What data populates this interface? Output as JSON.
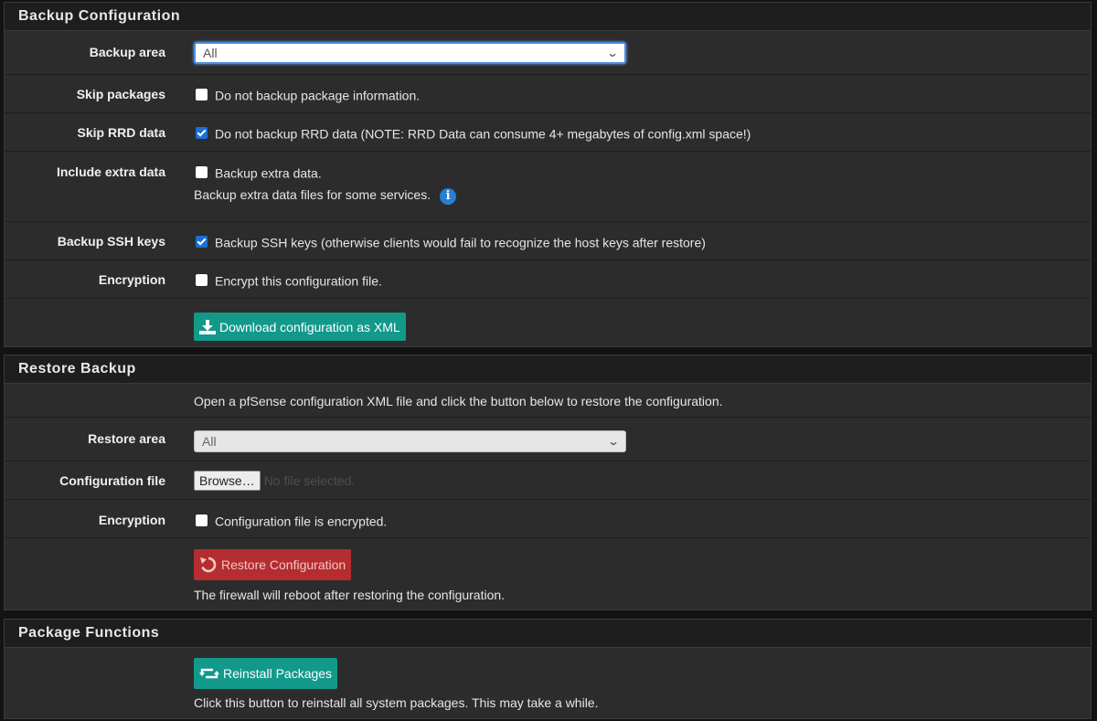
{
  "backup": {
    "title": "Backup Configuration",
    "area_label": "Backup area",
    "area_value": "All",
    "skip_packages_label": "Skip packages",
    "skip_packages_text": "Do not backup package information.",
    "skip_packages_checked": false,
    "skip_rrd_label": "Skip RRD data",
    "skip_rrd_text": "Do not backup RRD data (NOTE: RRD Data can consume 4+ megabytes of config.xml space!)",
    "skip_rrd_checked": true,
    "extra_label": "Include extra data",
    "extra_text": "Backup extra data.",
    "extra_help": "Backup extra data files for some services.",
    "extra_checked": false,
    "ssh_label": "Backup SSH keys",
    "ssh_text": "Backup SSH keys (otherwise clients would fail to recognize the host keys after restore)",
    "ssh_checked": true,
    "encryption_label": "Encryption",
    "encryption_text": "Encrypt this configuration file.",
    "encryption_checked": false,
    "download_button": "Download configuration as XML"
  },
  "restore": {
    "title": "Restore Backup",
    "intro": "Open a pfSense configuration XML file and click the button below to restore the configuration.",
    "area_label": "Restore area",
    "area_value": "All",
    "file_label": "Configuration file",
    "browse_button": "Browse…",
    "no_file_text": "No file selected.",
    "encryption_label": "Encryption",
    "encryption_text": "Configuration file is encrypted.",
    "encryption_checked": false,
    "restore_button": "Restore Configuration",
    "restore_help": "The firewall will reboot after restoring the configuration."
  },
  "packages": {
    "title": "Package Functions",
    "reinstall_button": "Reinstall Packages",
    "reinstall_help": "Click this button to reinstall all system packages. This may take a while."
  },
  "icons": {
    "download": "download-icon",
    "restore": "undo-icon",
    "reinstall": "retweet-icon",
    "info": "info-icon"
  },
  "colors": {
    "green_button": "#12998a",
    "red_button": "#b52d30",
    "checkbox_on": "#1a6fd6",
    "info": "#2b7fd0"
  }
}
